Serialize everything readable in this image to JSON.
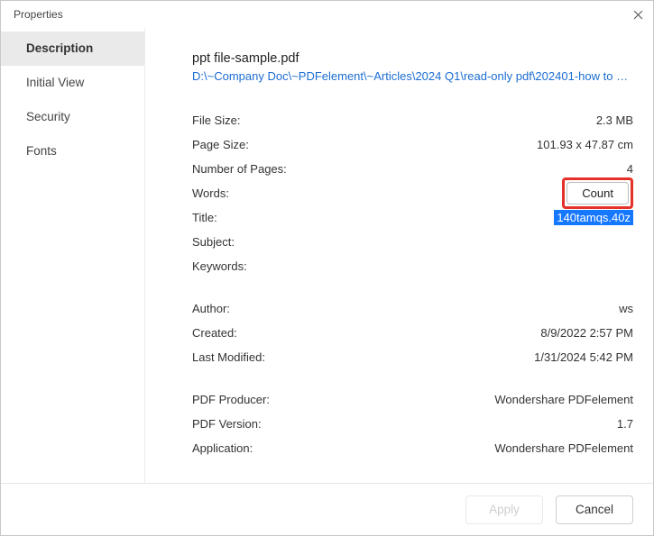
{
  "window": {
    "title": "Properties"
  },
  "sidebar": {
    "tabs": [
      {
        "label": "Description",
        "active": true
      },
      {
        "label": "Initial View",
        "active": false
      },
      {
        "label": "Security",
        "active": false
      },
      {
        "label": "Fonts",
        "active": false
      }
    ]
  },
  "doc": {
    "name": "ppt file-sample.pdf",
    "path": "D:\\~Company Doc\\~PDFelement\\~Articles\\2024 Q1\\read-only pdf\\202401-how to edit a read..."
  },
  "labels": {
    "file_size": "File Size:",
    "page_size": "Page Size:",
    "pages": "Number of Pages:",
    "words": "Words:",
    "title": "Title:",
    "subject": "Subject:",
    "keywords": "Keywords:",
    "author": "Author:",
    "created": "Created:",
    "modified": "Last Modified:",
    "producer": "PDF Producer:",
    "version": "PDF Version:",
    "application": "Application:"
  },
  "values": {
    "file_size": "2.3 MB",
    "page_size": "101.93 x 47.87 cm",
    "pages": "4",
    "words_button": "Count",
    "title": "140tamqs.40z",
    "subject": "",
    "keywords": "",
    "author": "ws",
    "created": "8/9/2022 2:57 PM",
    "modified": "1/31/2024 5:42 PM",
    "producer": "Wondershare PDFelement",
    "version": "1.7",
    "application": "Wondershare PDFelement"
  },
  "footer": {
    "apply": "Apply",
    "cancel": "Cancel"
  }
}
